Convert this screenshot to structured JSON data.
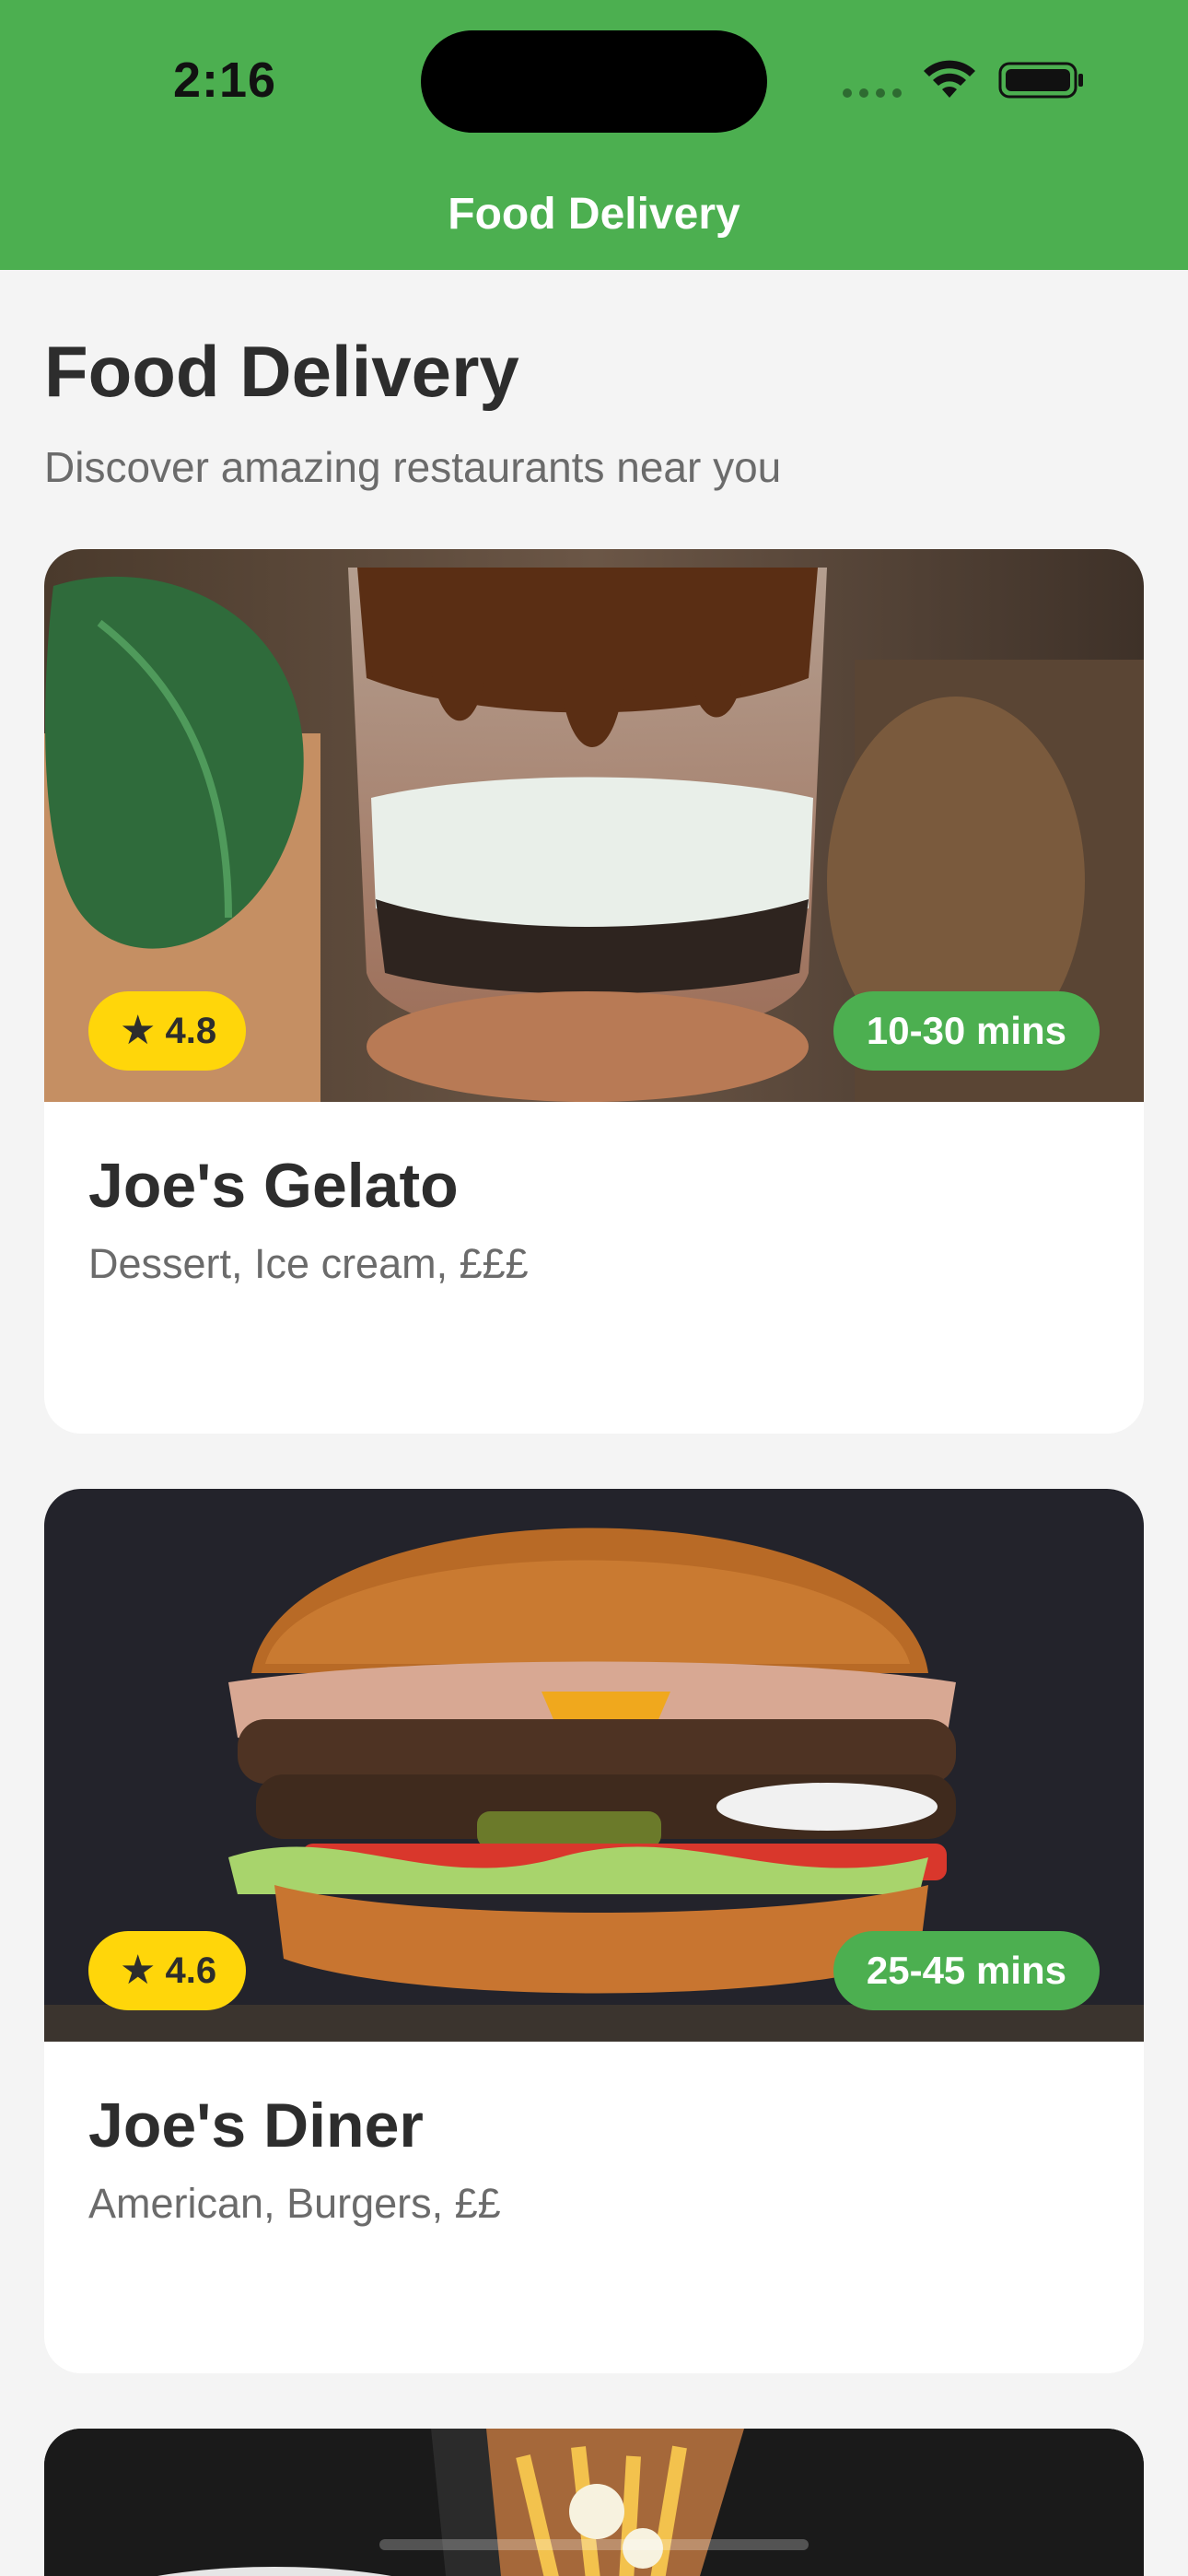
{
  "status_bar": {
    "time": "2:16"
  },
  "nav": {
    "title": "Food Delivery"
  },
  "intro": {
    "title": "Food Delivery",
    "subtitle": "Discover amazing restaurants near you"
  },
  "restaurants": [
    {
      "name": "Joe's Gelato",
      "tags": "Dessert, Ice cream, £££",
      "rating": "4.8",
      "delivery_time": "10-30 mins",
      "image": "chocolate-dessert-cup-photo"
    },
    {
      "name": "Joe's Diner",
      "tags": "American, Burgers, ££",
      "rating": "4.6",
      "delivery_time": "25-45 mins",
      "image": "double-cheeseburger-photo"
    },
    {
      "image": "fries-and-drink-photo"
    }
  ],
  "icons": {
    "rating": "star-icon",
    "signal": "cellular-signal-icon",
    "wifi": "wifi-icon",
    "battery": "battery-icon"
  },
  "colors": {
    "brand_green": "#4caf50",
    "rating_yellow": "#ffd60a",
    "background": "#f4f4f4",
    "card": "#ffffff"
  }
}
